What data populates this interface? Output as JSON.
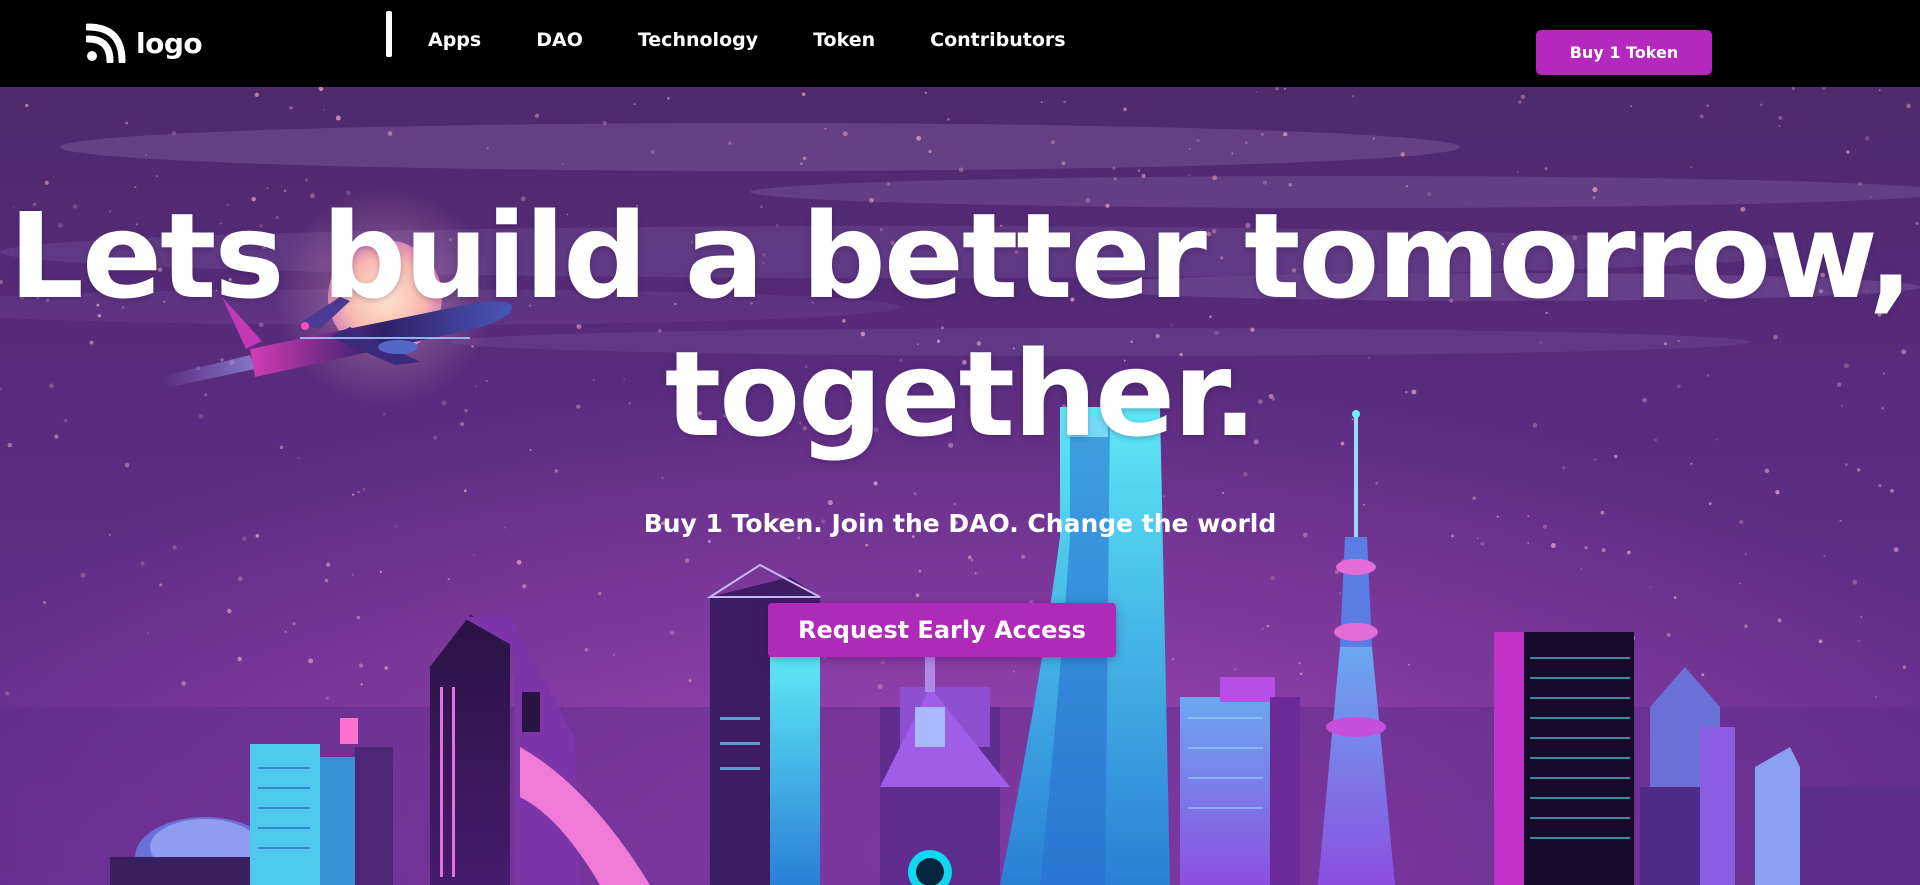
{
  "brand": {
    "logo_text": "logo",
    "logo_icon": "rss-feed-icon"
  },
  "nav": {
    "links": [
      "Apps",
      "DAO",
      "Technology",
      "Token",
      "Contributors"
    ],
    "buy_button": "Buy 1 Token"
  },
  "hero": {
    "title_line1": "Lets build a better tomorrow,",
    "title_line2": "together.",
    "subtitle": "Buy 1 Token. Join the DAO. Change the world",
    "cta": "Request Early Access",
    "background": "neon-city-skyline-illustration"
  },
  "colors": {
    "nav_bg": "#000000",
    "accent": "#b428be",
    "hero_sky_top": "#4f2a6e",
    "hero_sky_bottom": "#6b2d8f",
    "text": "#ffffff"
  }
}
